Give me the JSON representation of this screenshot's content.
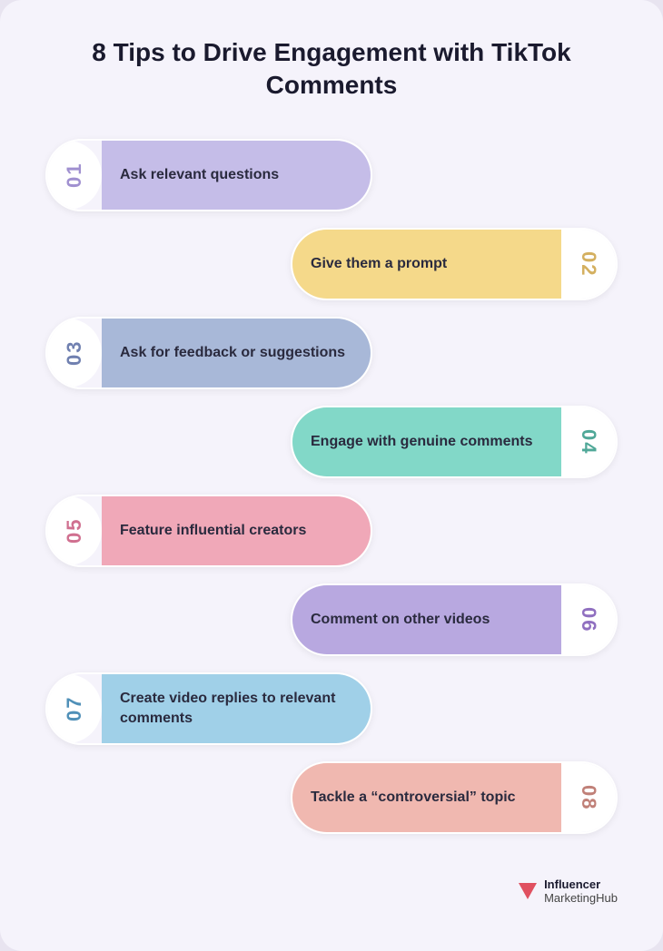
{
  "title": "8 Tips to Drive Engagement with TikTok Comments",
  "tips": [
    {
      "id": "01",
      "text": "Ask relevant questions",
      "color": "color-purple",
      "numColor": "num-color-01",
      "side": "left"
    },
    {
      "id": "02",
      "text": "Give them a prompt",
      "color": "color-yellow",
      "numColor": "num-color-02",
      "side": "right"
    },
    {
      "id": "03",
      "text": "Ask for feedback or suggestions",
      "color": "color-blue",
      "numColor": "num-color-03",
      "side": "left"
    },
    {
      "id": "04",
      "text": "Engage with genuine comments",
      "color": "color-teal",
      "numColor": "num-color-04",
      "side": "right"
    },
    {
      "id": "05",
      "text": "Feature influential creators",
      "color": "color-pink",
      "numColor": "num-color-05",
      "side": "left"
    },
    {
      "id": "06",
      "text": "Comment on other videos",
      "color": "color-lavender",
      "numColor": "num-color-06",
      "side": "right"
    },
    {
      "id": "07",
      "text": "Create video replies to relevant comments",
      "color": "color-lightblue",
      "numColor": "num-color-07",
      "side": "left"
    },
    {
      "id": "08",
      "text": "Tackle a “controversial” topic",
      "color": "color-salmon",
      "numColor": "num-color-08",
      "side": "right"
    }
  ],
  "brand": {
    "name": "Influencer",
    "sub": "MarketingHub"
  }
}
